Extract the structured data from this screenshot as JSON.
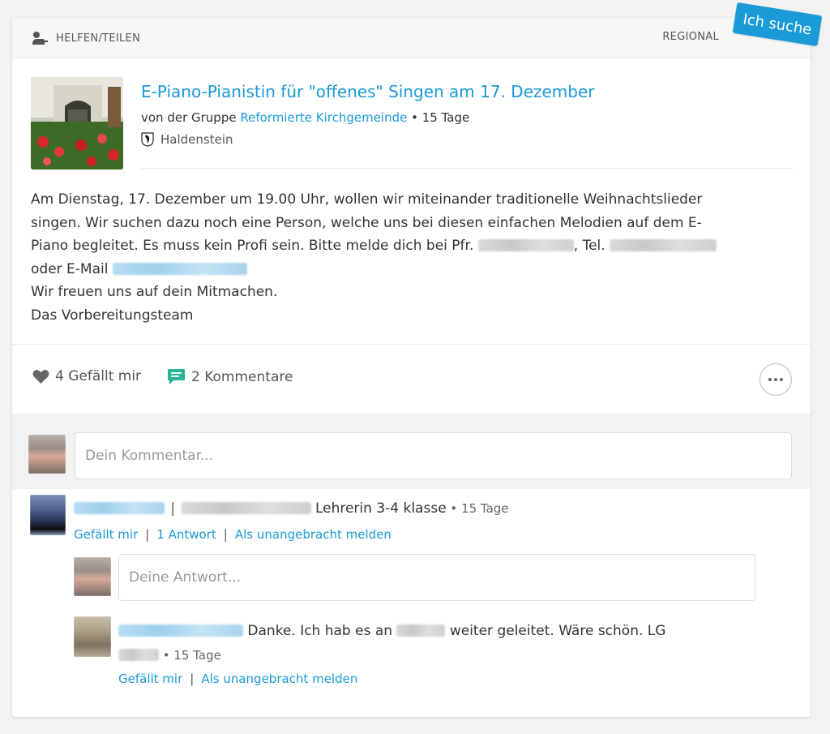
{
  "header": {
    "category": "HELFEN/TEILEN",
    "scope": "REGIONAL",
    "ribbon": "Ich suche",
    "category_icon": "person-help-icon"
  },
  "post": {
    "title": "E-Piano-Pianistin für \"offenes\" Singen am 17. Dezember",
    "by_prefix": "von der Gruppe ",
    "group": "Reformierte Kirchgemeinde",
    "age": " • 15 Tage",
    "location": "Haldenstein",
    "body": {
      "l1": "Am Dienstag, 17. Dezember um 19.00 Uhr, wollen wir miteinander traditionelle Weihnachtslieder",
      "l2": "singen. Wir suchen dazu noch eine Person, welche uns bei diesen einfachen Melodien auf dem E-",
      "l3a": "Piano begleitet. Es muss kein Profi sein. Bitte melde dich bei Pfr. ",
      "l3b": ", Tel. ",
      "l4": "oder E-Mail ",
      "l5": "Wir freuen uns auf dein Mitmachen.",
      "l6": "Das Vorbereitungsteam"
    }
  },
  "actions": {
    "likes": "4 Gefällt mir",
    "comments": "2 Kommentare",
    "colors": {
      "comment_icon": "#2bb39a",
      "link": "#1a9ad6"
    }
  },
  "comment_input": {
    "placeholder": "Dein Kommentar..."
  },
  "comment1": {
    "role": "Lehrerin 3-4 klasse",
    "age": " • 15 Tage",
    "like": "Gefällt mir",
    "reply": "1 Antwort",
    "report": "Als unangebracht melden"
  },
  "reply_input": {
    "placeholder": "Deine Antwort..."
  },
  "reply1": {
    "text_a": "Danke. Ich hab es an ",
    "text_b": " weiter geleitet. Wäre schön. LG",
    "age": " • 15 Tage",
    "like": "Gefällt mir",
    "report": "Als unangebracht melden"
  }
}
